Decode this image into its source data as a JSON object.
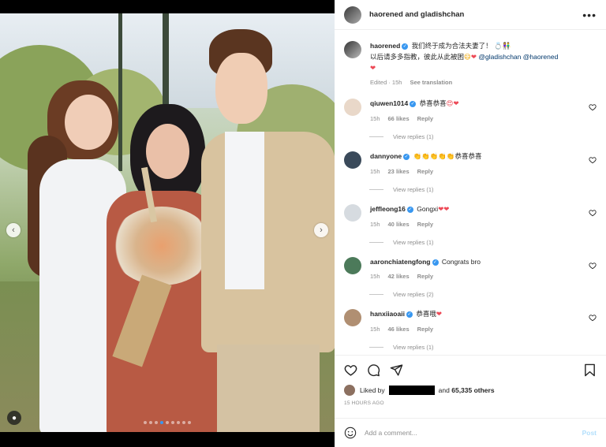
{
  "header": {
    "title": "haorened and gladishchan",
    "more_icon": "more-horizontal-icon"
  },
  "caption": {
    "username": "haorened",
    "text_line1": "我们终于成为合法夫妻了！",
    "text_line2": "以后请多多指教，彼此从此被困",
    "mention1": "@gladishchan",
    "mention2": "@haorened",
    "edited": "Edited · 15h",
    "see_translation": "See translation"
  },
  "comments": [
    {
      "username": "qiuwen1014",
      "verified": true,
      "text": "恭喜恭喜",
      "emoji": "😍❤",
      "time": "15h",
      "likes": "66 likes",
      "reply": "Reply",
      "view_replies": "View replies (1)"
    },
    {
      "username": "dannyone",
      "verified": true,
      "text": "恭喜恭喜",
      "emoji": "👏👏👏👏👏",
      "time": "15h",
      "likes": "23 likes",
      "reply": "Reply",
      "view_replies": "View replies (1)"
    },
    {
      "username": "jeffleong16",
      "verified": true,
      "text": "Gongxi",
      "emoji": "❤❤",
      "time": "15h",
      "likes": "40 likes",
      "reply": "Reply",
      "view_replies": "View replies (1)"
    },
    {
      "username": "aaronchiatengfong",
      "verified": true,
      "text": "Congrats bro",
      "emoji": "",
      "time": "15h",
      "likes": "42 likes",
      "reply": "Reply",
      "view_replies": "View replies (2)"
    },
    {
      "username": "hanxiiaoaii",
      "verified": true,
      "text": "恭喜哦",
      "emoji": "❤",
      "time": "15h",
      "likes": "46 likes",
      "reply": "Reply",
      "view_replies": "View replies (1)"
    }
  ],
  "likes": {
    "prefix": "Liked by",
    "suffix_and": "and",
    "count": "65,335 others"
  },
  "posted": "15 HOURS AGO",
  "add_comment": {
    "placeholder": "Add a comment...",
    "post_label": "Post"
  },
  "photo": {
    "carousel_total": 9,
    "carousel_active": 3
  },
  "colors": {
    "verified": "#3897f0",
    "heart": "#ed4956",
    "link": "#00376b"
  }
}
